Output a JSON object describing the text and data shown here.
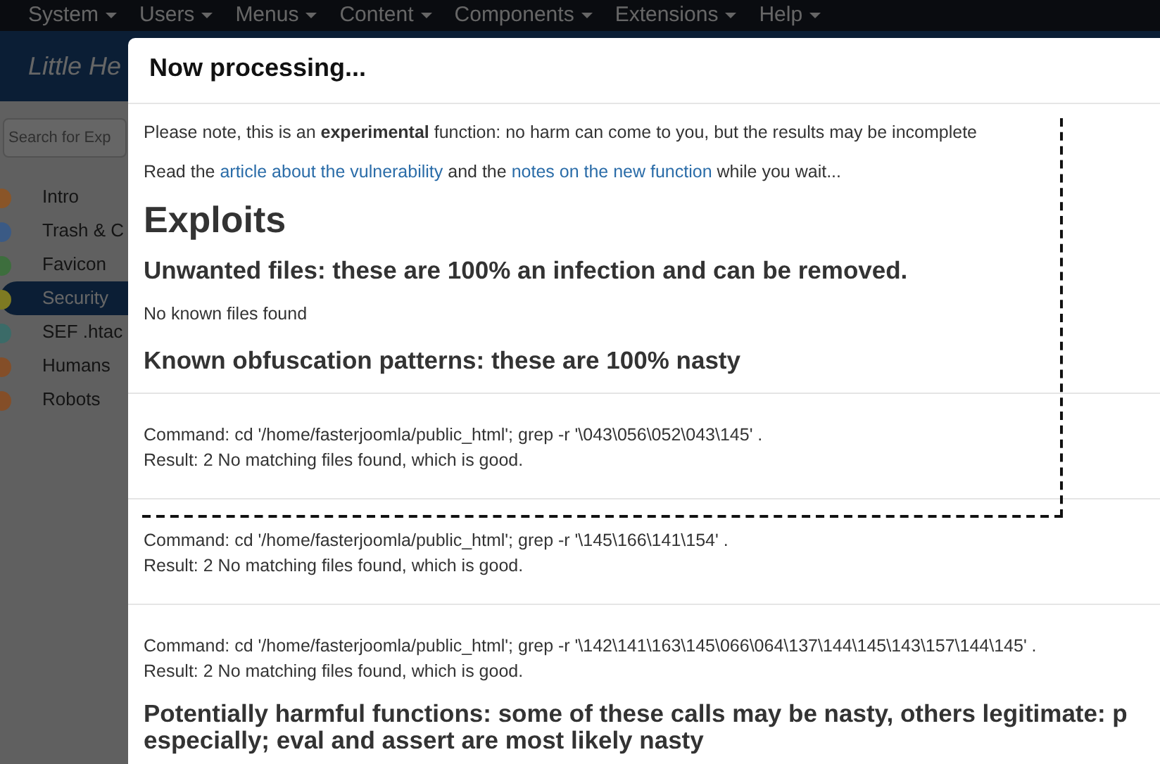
{
  "navbar": {
    "menus": [
      {
        "label": "System"
      },
      {
        "label": "Users"
      },
      {
        "label": "Menus"
      },
      {
        "label": "Content"
      },
      {
        "label": "Components"
      },
      {
        "label": "Extensions"
      },
      {
        "label": "Help"
      }
    ]
  },
  "header": {
    "title": "Little He"
  },
  "search": {
    "placeholder": "Search for Exp"
  },
  "sidebar": {
    "items": [
      {
        "label": "Intro",
        "color": "#8a5528",
        "selected": false
      },
      {
        "label": "Trash & C",
        "color": "#3a5a85",
        "selected": false
      },
      {
        "label": "Favicon",
        "color": "#3d6e3d",
        "selected": false
      },
      {
        "label": "Security",
        "color": "#7e7a22",
        "selected": true
      },
      {
        "label": "SEF .htac",
        "color": "#3b6b68",
        "selected": false
      },
      {
        "label": "Humans",
        "color": "#844e28",
        "selected": false
      },
      {
        "label": "Robots",
        "color": "#844e28",
        "selected": false
      }
    ]
  },
  "modal": {
    "title": "Now processing...",
    "notice": "Please note, this is an **experimental** function: no harm can come to you, but the results may be incomplete",
    "read_line": {
      "before": "Read the",
      "link_1": "article about the vulnerability",
      "middle": "and the",
      "link_2": "notes on the new function",
      "after": "while you wait..."
    },
    "heading": "Exploits",
    "sections": [
      {
        "kind": "heading",
        "lines": [
          "Unwanted files: these are 100% an infection and can be removed."
        ]
      },
      {
        "kind": "message",
        "text": "No known files found"
      },
      {
        "kind": "heading",
        "lines": [
          "Known obfuscation patterns: these are 100% nasty"
        ]
      },
      {
        "kind": "command",
        "command": "Command: cd '/home/fasterjoomla/public_html'; grep -r '\\043\\056\\052\\043\\145' .",
        "result": "Result: 2 No matching files found, which is good."
      },
      {
        "kind": "command",
        "command": "Command: cd '/home/fasterjoomla/public_html'; grep -r '\\145\\166\\141\\154' .",
        "result": "Result: 2 No matching files found, which is good."
      },
      {
        "kind": "command",
        "command": "Command: cd '/home/fasterjoomla/public_html'; grep -r '\\142\\141\\163\\145\\066\\064\\137\\144\\145\\143\\157\\144\\145' .",
        "result": "Result: 2 No matching files found, which is good."
      },
      {
        "kind": "heading",
        "lines": [
          "Potentially harmful functions: some of these calls may be nasty, others legitimate: p",
          "especially; eval and assert are most likely nasty"
        ]
      }
    ]
  }
}
